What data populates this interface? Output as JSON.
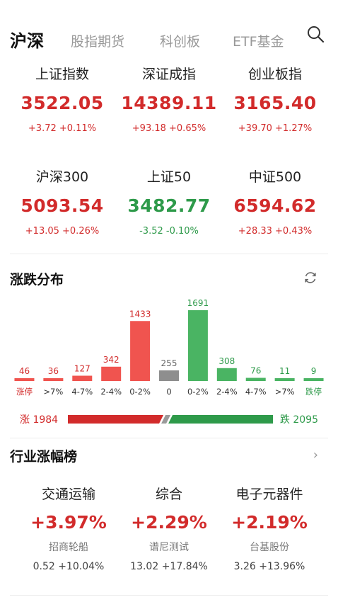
{
  "tabs": {
    "active": "沪深",
    "items": [
      "股指期货",
      "科创板",
      "ETF基金"
    ]
  },
  "indices": [
    {
      "name": "上证指数",
      "value": "3522.05",
      "change": "+3.72 +0.11%",
      "dir": "up"
    },
    {
      "name": "深证成指",
      "value": "14389.11",
      "change": "+93.18 +0.65%",
      "dir": "up"
    },
    {
      "name": "创业板指",
      "value": "3165.40",
      "change": "+39.70 +1.27%",
      "dir": "up"
    },
    {
      "name": "沪深300",
      "value": "5093.54",
      "change": "+13.05 +0.26%",
      "dir": "up"
    },
    {
      "name": "上证50",
      "value": "3482.77",
      "change": "-3.52 -0.10%",
      "dir": "down"
    },
    {
      "name": "中证500",
      "value": "6594.62",
      "change": "+28.33 +0.43%",
      "dir": "up"
    }
  ],
  "distribution": {
    "title": "涨跌分布",
    "refresh_icon": "refresh-icon",
    "colors": {
      "up": "#f0544f",
      "flat": "#8e8e8e",
      "down": "#4ab463"
    },
    "chart_data": {
      "type": "bar",
      "categories": [
        "涨停",
        ">7%",
        "4-7%",
        "2-4%",
        "0-2%",
        "0",
        "0-2%",
        "2-4%",
        "4-7%",
        ">7%",
        "跌停"
      ],
      "values": [
        46,
        36,
        127,
        342,
        1433,
        255,
        1691,
        308,
        76,
        11,
        9
      ],
      "kinds": [
        "up",
        "up",
        "up",
        "up",
        "up",
        "flat",
        "down",
        "down",
        "down",
        "down",
        "down"
      ]
    },
    "up_label": "涨 1984",
    "down_label": "跌 2095",
    "up_count": 1984,
    "down_count": 2095
  },
  "industry": {
    "title": "行业涨幅榜",
    "chevron": "›",
    "items": [
      {
        "name": "交通运输",
        "pct": "+3.97%",
        "stock": "招商轮船",
        "detail": "0.52 +10.04%"
      },
      {
        "name": "综合",
        "pct": "+2.29%",
        "stock": "谱尼测试",
        "detail": "13.02 +17.84%"
      },
      {
        "name": "电子元器件",
        "pct": "+2.19%",
        "stock": "台基股份",
        "detail": "3.26 +13.96%"
      }
    ]
  }
}
